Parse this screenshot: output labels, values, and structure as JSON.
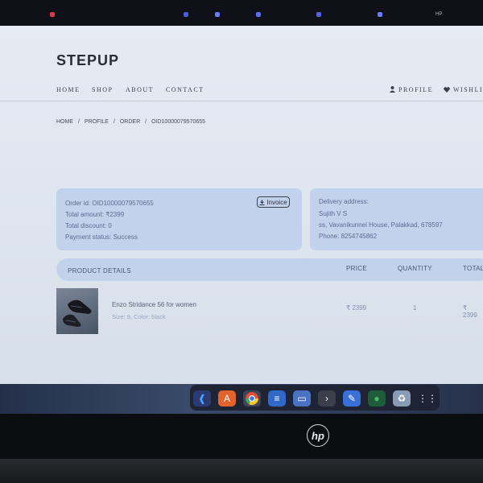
{
  "brand": "STEPUP",
  "nav": {
    "home": "HOME",
    "shop": "SHOP",
    "about": "ABOUT",
    "contact": "CONTACT",
    "profile": "PROFILE",
    "wishlist": "WISHLI"
  },
  "breadcrumb": {
    "home": "HOME",
    "profile": "PROFILE",
    "order": "ORDER",
    "order_id": "OID10000079570655",
    "sep": "/"
  },
  "order": {
    "order_id": "Order id: OID10000079570655",
    "total_amount": "Total amount: ₹2399",
    "total_discount": "Total discount: 0",
    "payment_status": "Payment status: Success",
    "invoice_button": "Invoice"
  },
  "delivery": {
    "heading": "Delivery address:",
    "name": "Sujith V S",
    "address": "ss, Vavanikunnel House, Palakkad, 678597",
    "phone": "Phone: 8254745862"
  },
  "table": {
    "product_details": "PRODUCT DETAILS",
    "price": "PRICE",
    "quantity": "QUANTITY",
    "total": "TOTAL"
  },
  "item": {
    "name": "Enzo Stridance 56 for women",
    "meta": "Size: 9, Color: black",
    "price": "₹ 2399",
    "quantity": "1",
    "total": "₹ 2399"
  },
  "laptop": {
    "topbar_label": "HP",
    "logo": "hp"
  },
  "icons": {
    "profile": "user-icon",
    "wishlist": "heart-icon",
    "invoice": "download-icon",
    "dock": [
      "vscode-icon",
      "app-store-icon",
      "chrome-icon",
      "text-editor-icon",
      "files-icon",
      "terminal-icon",
      "notes-icon",
      "mongodb-icon",
      "trash-icon",
      "app-grid-icon"
    ]
  }
}
